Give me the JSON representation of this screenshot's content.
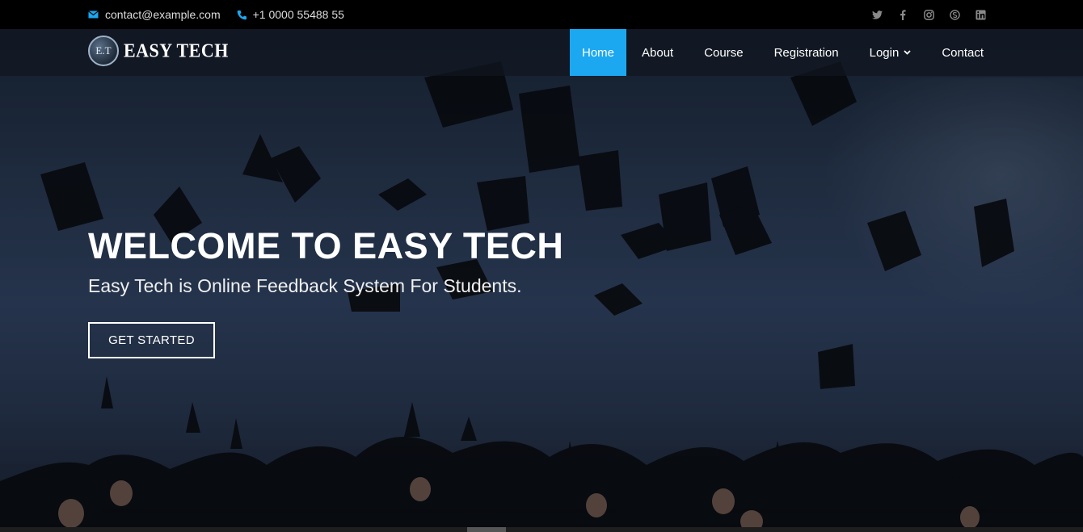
{
  "topbar": {
    "email": "contact@example.com",
    "phone": "+1 0000 55488 55",
    "email_icon": "envelope-icon",
    "phone_icon": "phone-icon",
    "social": [
      "twitter-icon",
      "facebook-icon",
      "instagram-icon",
      "skype-icon",
      "linkedin-icon"
    ]
  },
  "brand": {
    "badge_text": "E.T",
    "name": "EASY TECH"
  },
  "nav": {
    "items": [
      {
        "label": "Home",
        "active": true
      },
      {
        "label": "About"
      },
      {
        "label": "Course"
      },
      {
        "label": "Registration"
      },
      {
        "label": "Login",
        "dropdown": true
      },
      {
        "label": "Contact"
      }
    ]
  },
  "hero": {
    "title": "WELCOME TO EASY TECH",
    "subtitle": "Easy Tech is Online Feedback System For Students.",
    "cta_label": "GET STARTED"
  },
  "colors": {
    "accent": "#1ba8f0",
    "topbar_bg": "#000000",
    "icon_blue": "#1ba8f0"
  }
}
